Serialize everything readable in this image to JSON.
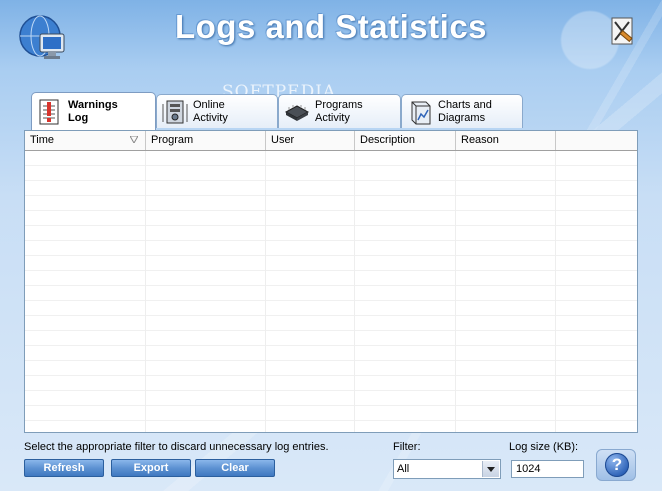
{
  "header": {
    "title": "Logs and Statistics",
    "watermark": "SOFTPEDIA"
  },
  "tabs": [
    {
      "line1": "Warnings",
      "line2": "Log",
      "active": true,
      "icon": "warning-log-icon"
    },
    {
      "line1": "Online",
      "line2": "Activity",
      "active": false,
      "icon": "server-icon"
    },
    {
      "line1": "Programs",
      "line2": "Activity",
      "active": false,
      "icon": "chip-icon"
    },
    {
      "line1": "Charts and",
      "line2": "Diagrams",
      "active": false,
      "icon": "charts-icon"
    }
  ],
  "table": {
    "columns": [
      "Time",
      "Program",
      "User",
      "Description",
      "Reason",
      ""
    ],
    "rows": []
  },
  "footer": {
    "hint": "Select the appropriate filter to discard unnecessary log entries.",
    "filter_label": "Filter:",
    "filter_value": "All",
    "logsize_label": "Log size (KB):",
    "logsize_value": "1024",
    "buttons": {
      "refresh": "Refresh",
      "export": "Export",
      "clear": "Clear"
    },
    "help_symbol": "?"
  },
  "colors": {
    "accent": "#5d92d2",
    "background_top": "#7fb2e6",
    "background_bottom": "#d9e8f8"
  }
}
